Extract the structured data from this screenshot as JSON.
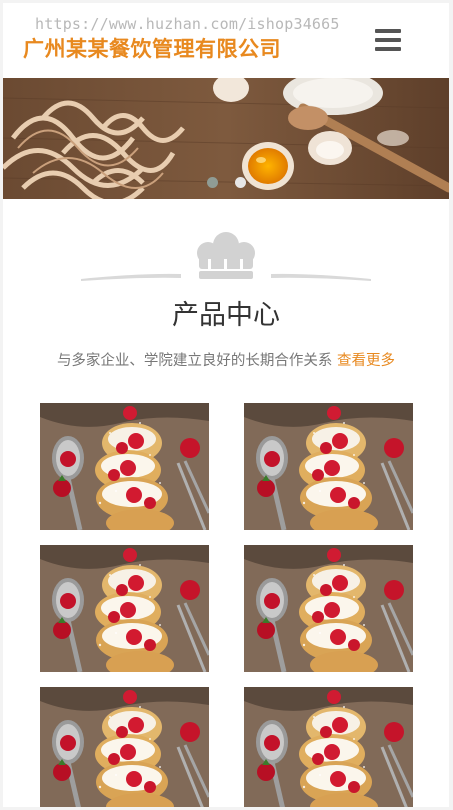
{
  "header": {
    "watermark": "https://www.huzhan.com/ishop34665",
    "brand_name": "广州某某餐饮管理有限公司",
    "menu_icon": "hamburger-menu-icon"
  },
  "banner": {
    "slide_count": 2,
    "active_slide": 1
  },
  "product_section": {
    "icon": "chef-hat-icon",
    "title": "产品中心",
    "subtitle": "与多家企业、学院建立良好的长期合作关系",
    "more_link": "查看更多",
    "products": [
      {
        "image": "strawberry-cream-puff-photo"
      },
      {
        "image": "strawberry-cream-puff-photo"
      },
      {
        "image": "strawberry-cream-puff-photo"
      },
      {
        "image": "strawberry-cream-puff-photo"
      },
      {
        "image": "strawberry-cream-puff-photo"
      },
      {
        "image": "strawberry-cream-puff-photo"
      }
    ]
  },
  "colors": {
    "accent": "#e8891f",
    "text": "#333333",
    "muted": "#777777"
  }
}
